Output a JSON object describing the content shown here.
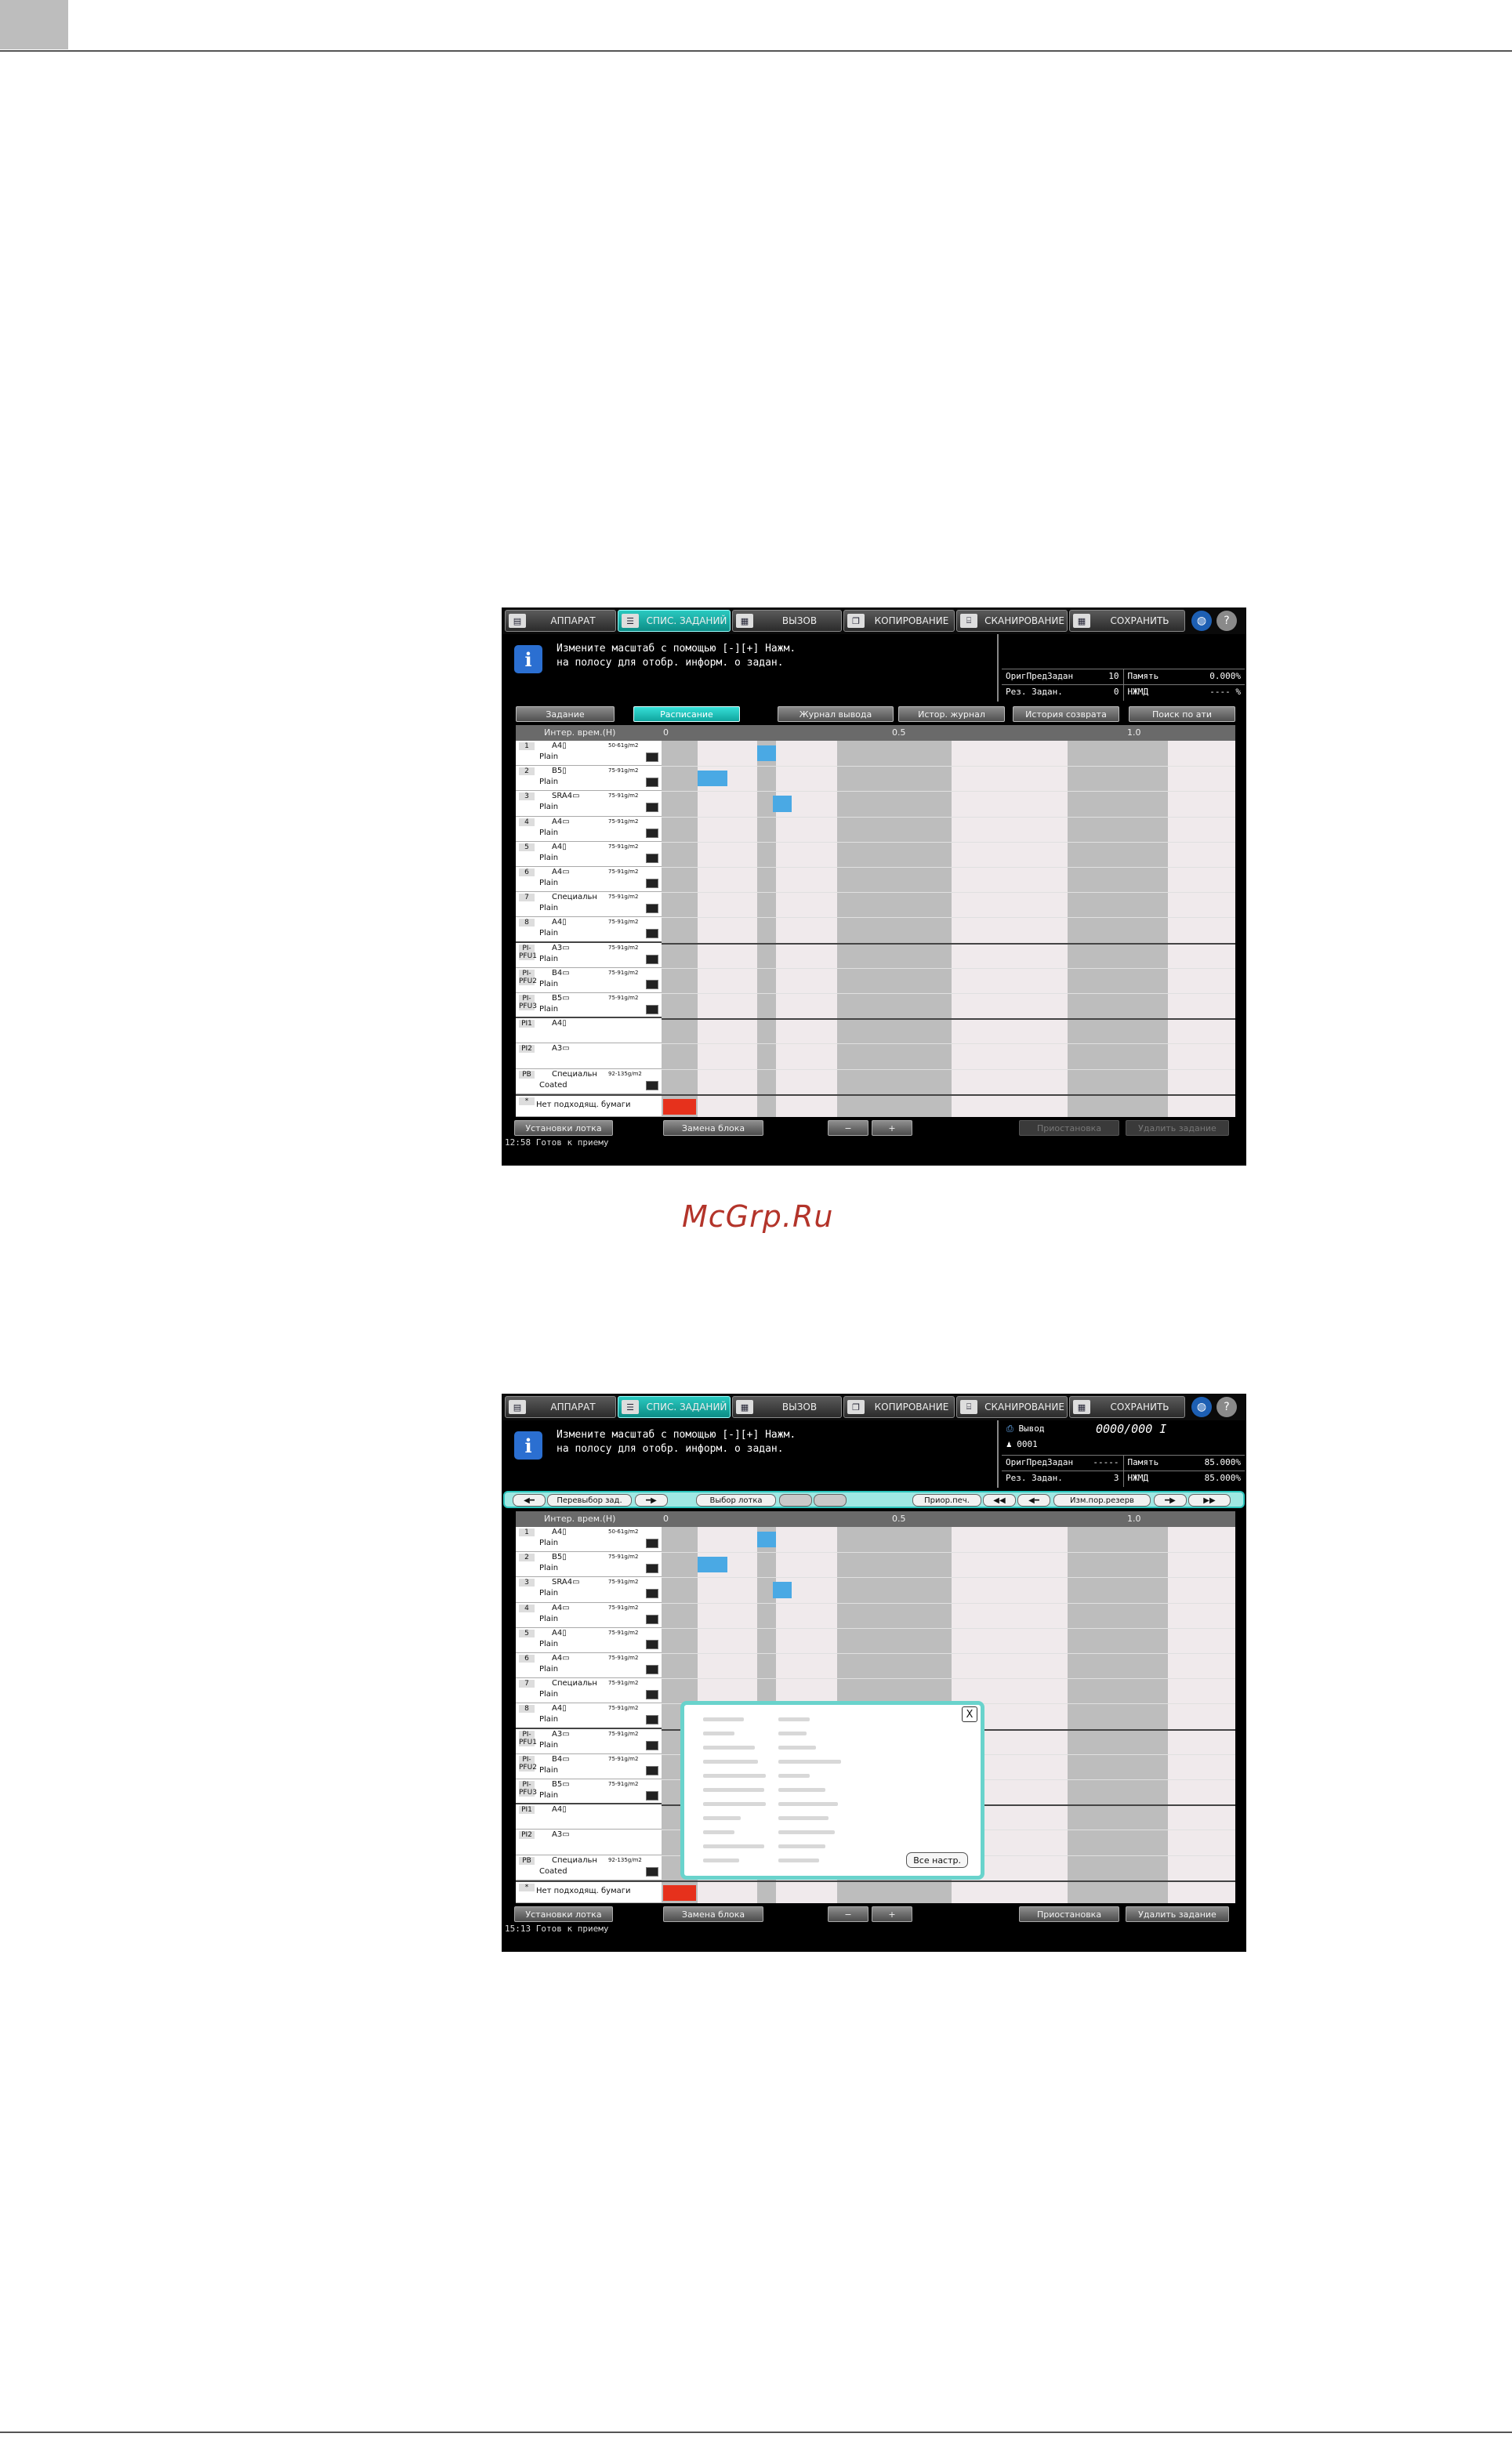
{
  "watermark": "McGrp.Ru",
  "screens": [
    {
      "topbar": {
        "tabs": [
          {
            "label": "АППАРАТ",
            "icon": "machine-icon"
          },
          {
            "label": "СПИС. ЗАДАНИЙ",
            "icon": "job-list-icon",
            "active": true
          },
          {
            "label": "ВЫЗОВ",
            "icon": "recall-icon"
          },
          {
            "label": "КОПИРОВАНИЕ",
            "icon": "copy-icon"
          },
          {
            "label": "СКАНИРОВАНИЕ",
            "icon": "scan-icon"
          },
          {
            "label": "СОХРАНИТЬ",
            "icon": "store-icon"
          }
        ]
      },
      "message": "Измените масштаб с помощью [-][+] Нажм.\nна полосу для отобр. информ. о задан.",
      "status": {
        "orig_label": "ОригПредЗадан",
        "orig_value": "10",
        "mem_label": "Память",
        "mem_value": "0.000%",
        "res_label": "Рез. Задан.",
        "res_value": "0",
        "hdd_label": "НЖМД",
        "hdd_value": "---- %"
      },
      "tabs": [
        "Задание",
        "Расписание",
        "Журнал вывода",
        "Истор. журнал",
        "История созврата",
        "Поиск по ати"
      ],
      "grid_header": {
        "interval": "Интер. врем.(Н)",
        "t0": "0",
        "t1": "0.5",
        "t2": "1.0"
      },
      "bottom": {
        "tray_settings": "Установки лотка",
        "replace": "Замена блока",
        "zoom_out": "−",
        "zoom_in": "+",
        "pause": "Приостановка",
        "delete": "Удалить задание"
      },
      "statusline": "12:58   Готов к приему"
    },
    {
      "output": {
        "label": "Вывод",
        "counter": "0000/000 I",
        "user": "0001"
      },
      "status": {
        "orig_label": "ОригПредЗадан",
        "orig_value": "-----",
        "mem_label": "Память",
        "mem_value": "85.000%",
        "res_label": "Рез. Задан.",
        "res_value": "3",
        "hdd_label": "НЖМД",
        "hdd_value": "85.000%"
      },
      "nav": {
        "reselect": "Перевыбор зад.",
        "tray_select": "Выбор лотка",
        "prior": "Приор.печ.",
        "change_reserve": "Изм.пор.резерв"
      },
      "popup": {
        "close": "X",
        "all_settings": "Все настр."
      },
      "statusline": "15:13   Готов к приему"
    }
  ],
  "rows": [
    {
      "num": "1",
      "size": "A4▯",
      "wt": "50-61g/m2",
      "kind": "Plain"
    },
    {
      "num": "2",
      "size": "B5▯",
      "wt": "75-91g/m2",
      "kind": "Plain"
    },
    {
      "num": "3",
      "size": "SRA4▭",
      "wt": "75-91g/m2",
      "kind": "Plain"
    },
    {
      "num": "4",
      "size": "A4▭",
      "wt": "75-91g/m2",
      "kind": "Plain"
    },
    {
      "num": "5",
      "size": "A4▯",
      "wt": "75-91g/m2",
      "kind": "Plain"
    },
    {
      "num": "6",
      "size": "A4▭",
      "wt": "75-91g/m2",
      "kind": "Plain"
    },
    {
      "num": "7",
      "size": "Специальн",
      "wt": "75-91g/m2",
      "kind": "Plain"
    },
    {
      "num": "8",
      "size": "A4▯",
      "wt": "75-91g/m2",
      "kind": "Plain"
    },
    {
      "num": "PI-PFU1",
      "size": "A3▭",
      "wt": "75-91g/m2",
      "kind": "Plain"
    },
    {
      "num": "PI-PFU2",
      "size": "B4▭",
      "wt": "75-91g/m2",
      "kind": "Plain"
    },
    {
      "num": "PI-PFU3",
      "size": "B5▭",
      "wt": "75-91g/m2",
      "kind": "Plain"
    },
    {
      "num": "PI1",
      "size": "A4▯",
      "wt": "",
      "kind": ""
    },
    {
      "num": "PI2",
      "size": "A3▭",
      "wt": "",
      "kind": ""
    },
    {
      "num": "PB",
      "size": "Специальн",
      "wt": "92-135g/m2",
      "kind": "Coated"
    }
  ],
  "no_paper": {
    "num": "*",
    "label": "Нет подходящ. бумаги"
  }
}
